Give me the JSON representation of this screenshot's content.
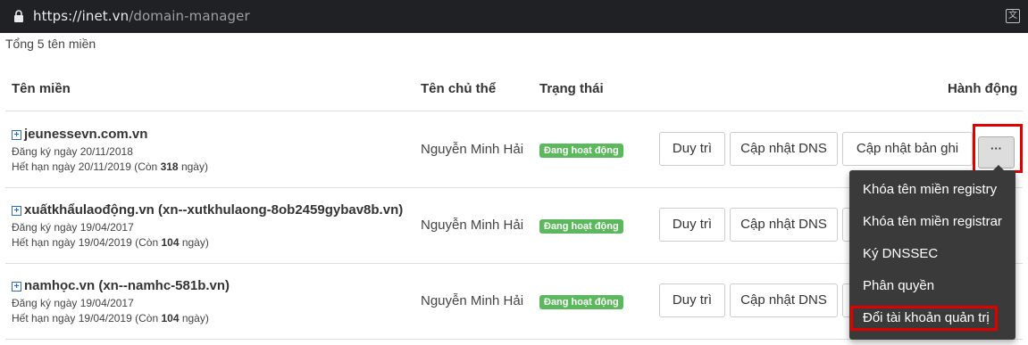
{
  "browser": {
    "url_host": "https://inet.vn",
    "url_path": "/domain-manager"
  },
  "summary": "Tổng 5 tên miền",
  "table": {
    "headers": {
      "domain": "Tên miền",
      "owner": "Tên chủ thể",
      "status": "Trạng thái",
      "actions": "Hành động"
    },
    "rows": [
      {
        "domain": "jeunessevn.com.vn",
        "registered": "Đăng ký ngày 20/11/2018",
        "expiry_prefix": "Hết hạn ngày 20/11/2019 (Còn ",
        "days_left": "318",
        "expiry_suffix": " ngày)",
        "owner": "Nguyễn Minh Hải",
        "status": "Đang hoạt động"
      },
      {
        "domain": "xuấtkhẩulaođộng.vn (xn--xutkhulaong-8ob2459gybav8b.vn)",
        "registered": "Đăng ký ngày 19/04/2017",
        "expiry_prefix": "Hết hạn ngày 19/04/2019 (Còn ",
        "days_left": "104",
        "expiry_suffix": " ngày)",
        "owner": "Nguyễn Minh Hải",
        "status": "Đang hoạt động"
      },
      {
        "domain": "namhọc.vn (xn--namhc-581b.vn)",
        "registered": "Đăng ký ngày 19/04/2017",
        "expiry_prefix": "Hết hạn ngày 19/04/2019 (Còn ",
        "days_left": "104",
        "expiry_suffix": " ngày)",
        "owner": "Nguyễn Minh Hải",
        "status": "Đang hoạt động"
      }
    ]
  },
  "actions": {
    "renew": "Duy trì",
    "update_dns": "Cập nhật DNS",
    "update_records": "Cập nhật bản ghi",
    "more": "···"
  },
  "dropdown": {
    "items": [
      "Khóa tên miền registry",
      "Khóa tên miền registrar",
      "Ký DNSSEC",
      "Phân quyền",
      "Đổi tài khoản quản trị"
    ]
  },
  "colors": {
    "status_active": "#5cb85c",
    "highlight": "#e00000",
    "menu_bg": "#3a3a3a"
  },
  "icons": [
    "lock-icon",
    "translate-icon",
    "expand-plus-icon"
  ]
}
